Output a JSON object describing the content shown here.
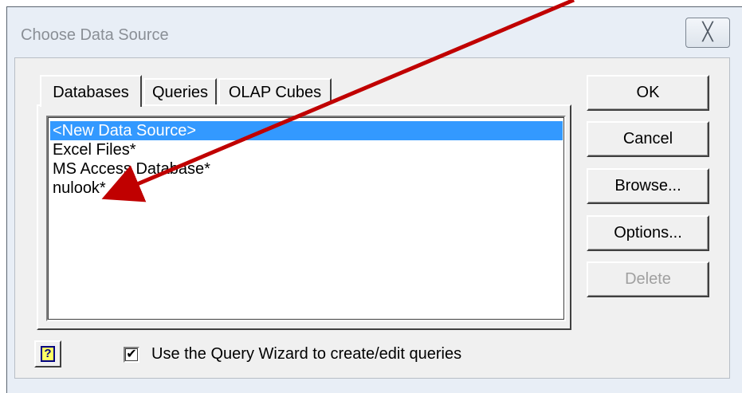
{
  "window": {
    "title": "Choose Data Source",
    "close_glyph": "╳"
  },
  "tabs": [
    {
      "label": "Databases",
      "selected": true
    },
    {
      "label": "Queries",
      "selected": false
    },
    {
      "label": "OLAP Cubes",
      "selected": false
    }
  ],
  "data_sources": [
    {
      "label": "<New Data Source>",
      "selected": true
    },
    {
      "label": "Excel Files*",
      "selected": false
    },
    {
      "label": "MS Access Database*",
      "selected": false
    },
    {
      "label": "nulook*",
      "selected": false
    }
  ],
  "buttons": {
    "ok": "OK",
    "cancel": "Cancel",
    "browse": "Browse...",
    "options": "Options...",
    "delete": "Delete"
  },
  "help_button": {
    "glyph": "?",
    "icon": "help-icon"
  },
  "query_wizard": {
    "label": "Use the Query Wizard to create/edit queries",
    "checked": true,
    "check_glyph": "✔"
  },
  "annotation": {
    "color": "#c00000"
  },
  "colors": {
    "selection": "#3399ff",
    "dialog_face": "#f0f0f0",
    "frame": "#e8eef6"
  }
}
